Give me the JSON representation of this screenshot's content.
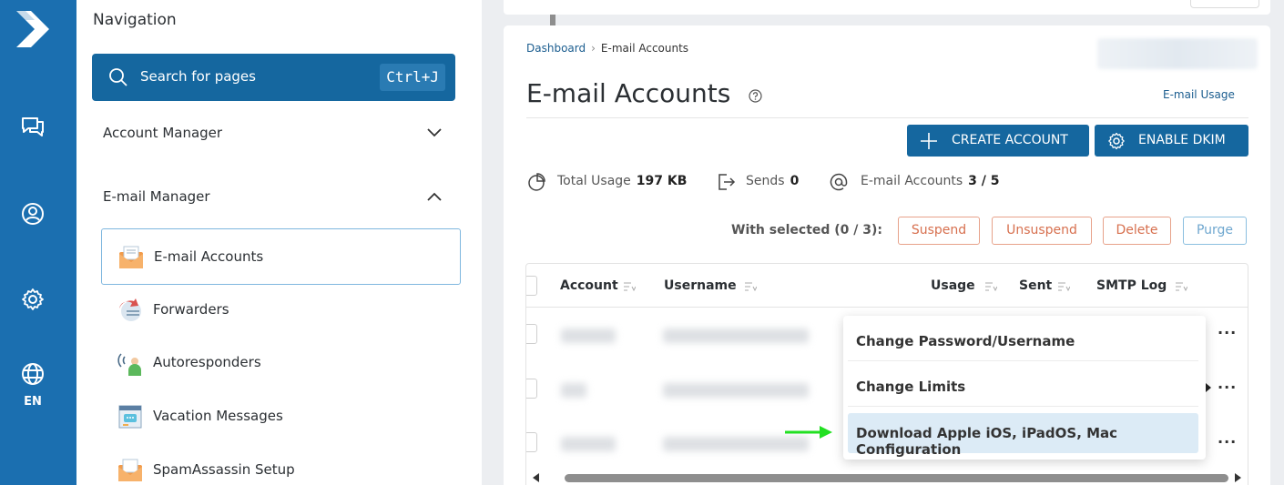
{
  "rail": {
    "logo": "logo-icon",
    "icons": [
      "chat-icon",
      "user-icon",
      "gear-icon",
      "globe-icon"
    ],
    "language": "EN"
  },
  "nav": {
    "title": "Navigation",
    "search_label": "Search for pages",
    "search_shortcut": "Ctrl+J",
    "sections": [
      {
        "label": "Account Manager",
        "expanded": false
      },
      {
        "label": "E-mail Manager",
        "expanded": true
      }
    ],
    "items": [
      {
        "label": "E-mail Accounts",
        "icon": "envelope-icon",
        "active": true
      },
      {
        "label": "Forwarders",
        "icon": "forward-icon",
        "active": false
      },
      {
        "label": "Autoresponders",
        "icon": "autoresponder-icon",
        "active": false
      },
      {
        "label": "Vacation Messages",
        "icon": "vacation-icon",
        "active": false
      },
      {
        "label": "SpamAssassin Setup",
        "icon": "spam-icon",
        "active": false
      }
    ]
  },
  "breadcrumb": {
    "home": "Dashboard",
    "separator": "›",
    "current": "E-mail Accounts"
  },
  "page": {
    "title": "E-mail Accounts",
    "usage_link": "E-mail Usage",
    "create_button": "CREATE ACCOUNT",
    "dkim_button": "ENABLE DKIM"
  },
  "stats": {
    "total_usage_label": "Total Usage",
    "total_usage_value": "197 KB",
    "sends_label": "Sends",
    "sends_value": "0",
    "accounts_label": "E-mail Accounts",
    "accounts_value": "3 / 5"
  },
  "bulk": {
    "with_selected": "With selected (0 / 3):",
    "suspend": "Suspend",
    "unsuspend": "Unsuspend",
    "delete": "Delete",
    "purge": "Purge"
  },
  "table": {
    "headers": [
      "Account",
      "Username",
      "Usage",
      "Sent",
      "SMTP Log"
    ],
    "row_menu": "..."
  },
  "dropdown": {
    "items": [
      "Change Password/Username",
      "Change Limits",
      "Download Apple iOS, iPadOS, Mac Configuration"
    ],
    "highlighted_index": 2
  },
  "colors": {
    "primary": "#15679f",
    "rail": "#1b6fb0",
    "danger_outline": "#e7a28a",
    "highlight": "#dcebf6",
    "annotation_arrow": "#22e022"
  }
}
